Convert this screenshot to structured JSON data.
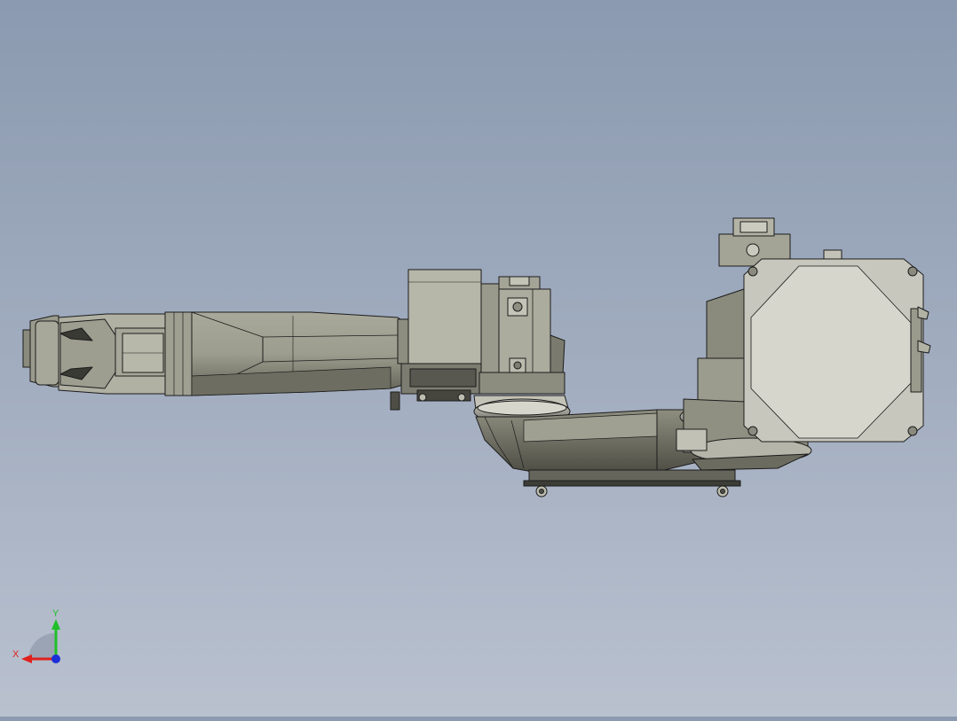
{
  "viewport": {
    "background_top": "#8b9ab0",
    "background_bottom": "#b9c1cf",
    "model_face_color": "#b4b4a6",
    "model_shade_color": "#6e6e62",
    "model_edge_color": "#1c1c1c"
  },
  "triad": {
    "x_label": "X",
    "y_label": "Y",
    "x_color": "#e0201c",
    "y_color": "#1fbf2a",
    "z_color": "#1c2fd8"
  }
}
